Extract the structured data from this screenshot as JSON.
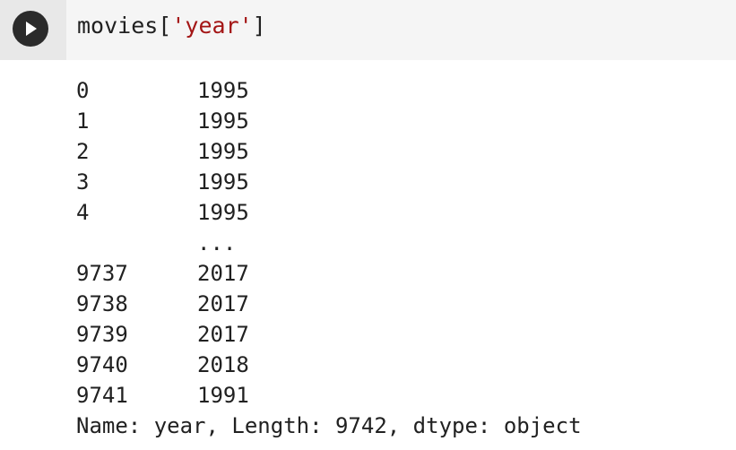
{
  "code_cell": {
    "code_prefix": "movies[",
    "code_string": "'year'",
    "code_suffix": "]",
    "run_icon": "play-icon"
  },
  "output": {
    "rows": [
      {
        "index": "0",
        "value": "1995"
      },
      {
        "index": "1",
        "value": "1995"
      },
      {
        "index": "2",
        "value": "1995"
      },
      {
        "index": "3",
        "value": "1995"
      },
      {
        "index": "4",
        "value": "1995"
      },
      {
        "index": "",
        "value": "..."
      },
      {
        "index": "9737",
        "value": "2017"
      },
      {
        "index": "9738",
        "value": "2017"
      },
      {
        "index": "9739",
        "value": "2017"
      },
      {
        "index": "9740",
        "value": "2018"
      },
      {
        "index": "9741",
        "value": "1991"
      }
    ],
    "footer": "Name: year, Length: 9742, dtype: object"
  }
}
